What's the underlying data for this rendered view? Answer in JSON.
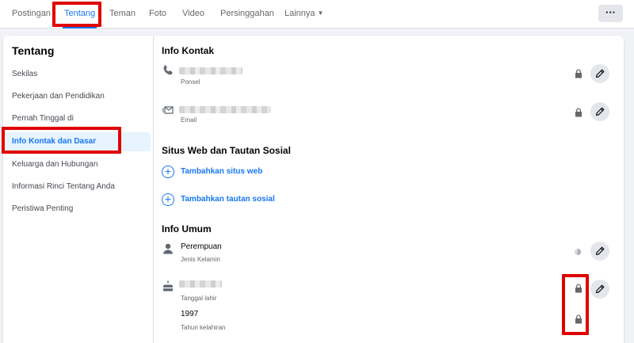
{
  "tabs": [
    {
      "label": "Postingan"
    },
    {
      "label": "Tentang"
    },
    {
      "label": "Teman"
    },
    {
      "label": "Foto"
    },
    {
      "label": "Video"
    },
    {
      "label": "Persinggahan"
    },
    {
      "label": "Lainnya"
    }
  ],
  "active_tab": "Tentang",
  "more_button": "···",
  "sidebar": {
    "title": "Tentang",
    "items": [
      {
        "label": "Sekilas"
      },
      {
        "label": "Pekerjaan dan Pendidikan"
      },
      {
        "label": "Pernah Tinggal di"
      },
      {
        "label": "Info Kontak dan Dasar"
      },
      {
        "label": "Keluarga dan Hubungan"
      },
      {
        "label": "Informasi Rinci Tentang Anda"
      },
      {
        "label": "Peristiwa Penting"
      }
    ],
    "active_item": "Info Kontak dan Dasar"
  },
  "contact": {
    "title": "Info Kontak",
    "phone": {
      "value": "",
      "label": "Ponsel",
      "icon": "phone-icon",
      "privacy": "lock-icon"
    },
    "email": {
      "value": "",
      "label": "Email",
      "icon": "envelope-icon",
      "privacy": "lock-icon"
    }
  },
  "social": {
    "title": "Situs Web dan Tautan Sosial",
    "add_website": "Tambahkan situs web",
    "add_social_link": "Tambahkan tautan sosial"
  },
  "basic_info": {
    "title": "Info Umum",
    "gender": {
      "value": "Perempuan",
      "label": "Jenis Kelamin",
      "icon": "person-icon",
      "privacy": "globe-icon"
    },
    "birthday": {
      "value": "",
      "label": "Tanggal lahir",
      "icon": "birthday-cake-icon",
      "privacy": "lock-icon"
    },
    "birth_year": {
      "value": "1997",
      "label": "Tahun kelahiran",
      "privacy": "lock-icon"
    }
  },
  "colors": {
    "accent": "#1877f2",
    "annotation": "#e00000",
    "background": "#f0f2f5"
  }
}
